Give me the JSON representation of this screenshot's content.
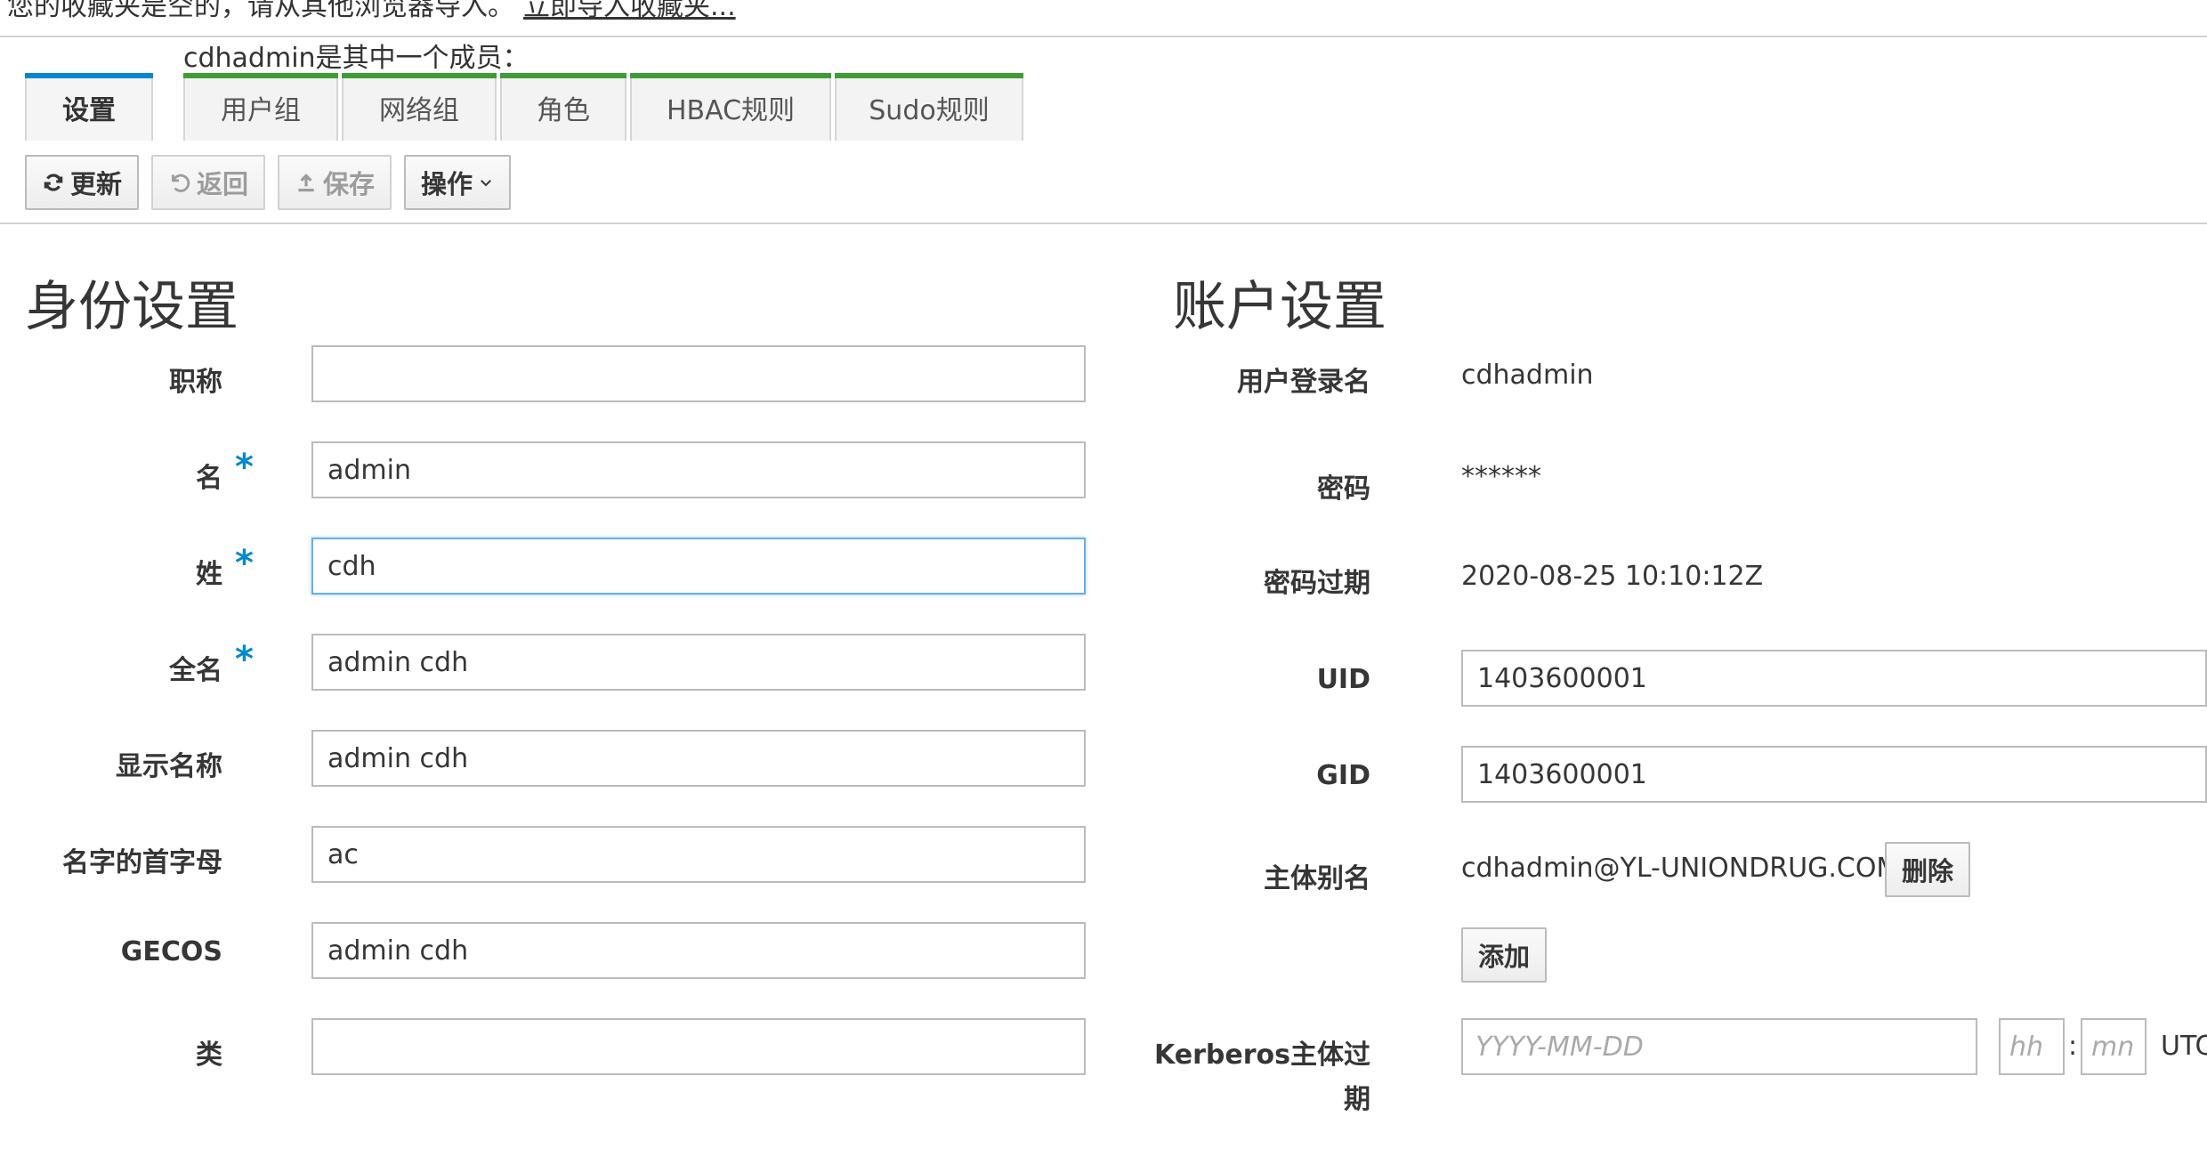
{
  "bookmarks_bar": {
    "message": "您的收藏夹是空的，请从其他浏览器导入。",
    "import_link": "立即导入收藏夹..."
  },
  "member_of_text": "cdhadmin是其中一个成员：",
  "tabs": {
    "settings": "设置",
    "user_groups": "用户组",
    "netgroups": "网络组",
    "roles": "角色",
    "hbac_rules": "HBAC规则",
    "sudo_rules": "Sudo规则"
  },
  "toolbar": {
    "refresh": "更新",
    "revert": "返回",
    "save": "保存",
    "actions": "操作"
  },
  "identity": {
    "title": "身份设置",
    "job_title_label": "职称",
    "job_title_value": "",
    "first_name_label": "名",
    "first_name_value": "admin",
    "last_name_label": "姓",
    "last_name_value": "cdh",
    "full_name_label": "全名",
    "full_name_value": "admin cdh",
    "display_name_label": "显示名称",
    "display_name_value": "admin cdh",
    "initials_label": "名字的首字母",
    "initials_value": "ac",
    "gecos_label": "GECOS",
    "gecos_value": "admin cdh",
    "class_label": "类",
    "class_value": "",
    "required_mark": "*"
  },
  "account": {
    "title": "账户设置",
    "login_label": "用户登录名",
    "login_value": "cdhadmin",
    "password_label": "密码",
    "password_value": "******",
    "password_expiration_label": "密码过期",
    "password_expiration_value": "2020-08-25 10:10:12Z",
    "uid_label": "UID",
    "uid_value": "1403600001",
    "gid_label": "GID",
    "gid_value": "1403600001",
    "principal_alias_label": "主体别名",
    "principal_alias_value": "cdhadmin@YL-UNIONDRUG.COM",
    "delete_button": "删除",
    "add_button": "添加",
    "kerberos_expiration_label_line1": "Kerberos主体过",
    "kerberos_expiration_label_line2": "期",
    "date_placeholder": "YYYY-MM-DD",
    "hour_placeholder": "hh",
    "minute_placeholder": "mn",
    "time_separator": ":",
    "timezone": "UTC"
  },
  "colors": {
    "active_tab_accent": "#0088ce",
    "tab_accent": "#3f9c35",
    "required": "#0088ce",
    "focus_border": "#66afe9"
  }
}
